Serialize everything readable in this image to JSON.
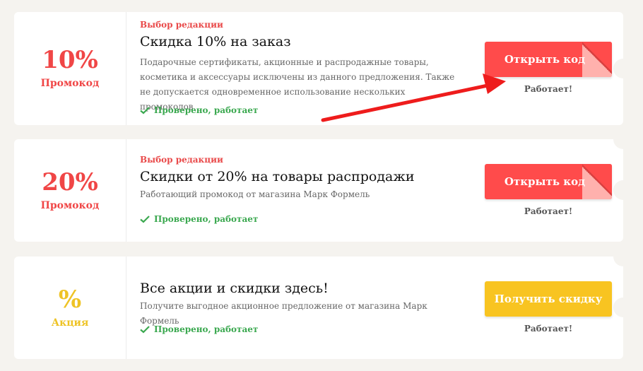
{
  "colors": {
    "red": "#ff4b4b",
    "yellow": "#f8c421",
    "green": "#3aa84f"
  },
  "offers": [
    {
      "discount": "10%",
      "type": "Промокод",
      "editor_pick": "Выбор редакции",
      "title": "Скидка 10% на заказ",
      "description": "Подарочные сертификаты, акционные и распродажные товары, косметика и аксессуары исключены из данного предложения. Также не допускается одновременное использование нескольких промокодов.",
      "verified": "Проверено, работает",
      "button": "Открыть код",
      "status": "Работает!"
    },
    {
      "discount": "20%",
      "type": "Промокод",
      "editor_pick": "Выбор редакции",
      "title": "Скидки от 20% на товары распродажи",
      "description": "Работающий промокод от магазина Марк Формель",
      "verified": "Проверено, работает",
      "button": "Открыть код",
      "status": "Работает!"
    },
    {
      "discount": "%",
      "type": "Акция",
      "title": "Все акции и скидки здесь!",
      "description": "Получите выгодное акционное предложение от магазина Марк Формель",
      "verified": "Проверено, работает",
      "button": "Получить скидку",
      "status": "Работает!"
    }
  ]
}
